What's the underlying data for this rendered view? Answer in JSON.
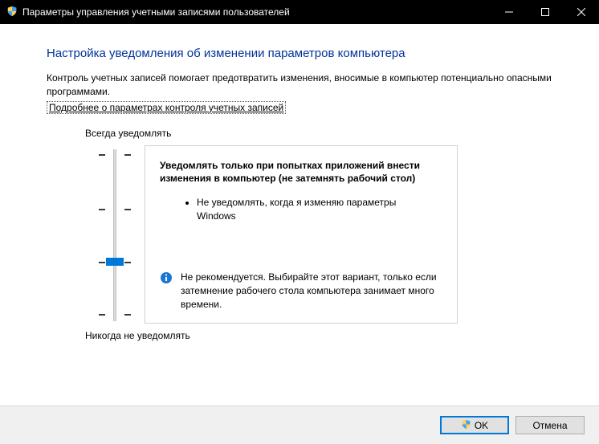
{
  "window": {
    "title": "Параметры управления учетными записями пользователей"
  },
  "page": {
    "heading": "Настройка уведомления об изменении параметров компьютера",
    "description": "Контроль учетных записей помогает предотвратить изменения, вносимые в компьютер потенциально опасными программами.",
    "link": "Подробнее о параметрах контроля учетных записей"
  },
  "slider": {
    "top_label": "Всегда уведомлять",
    "bottom_label": "Никогда не уведомлять",
    "levels": 4,
    "current_level_index": 2
  },
  "level_description": {
    "title": "Уведомлять только при попытках приложений внести изменения в компьютер (не затемнять рабочий стол)",
    "bullets": [
      "Не уведомлять, когда я изменяю параметры Windows"
    ],
    "recommendation": "Не рекомендуется. Выбирайте этот вариант, только если затемнение рабочего стола компьютера занимает много времени."
  },
  "buttons": {
    "ok": "OK",
    "cancel": "Отмена"
  }
}
